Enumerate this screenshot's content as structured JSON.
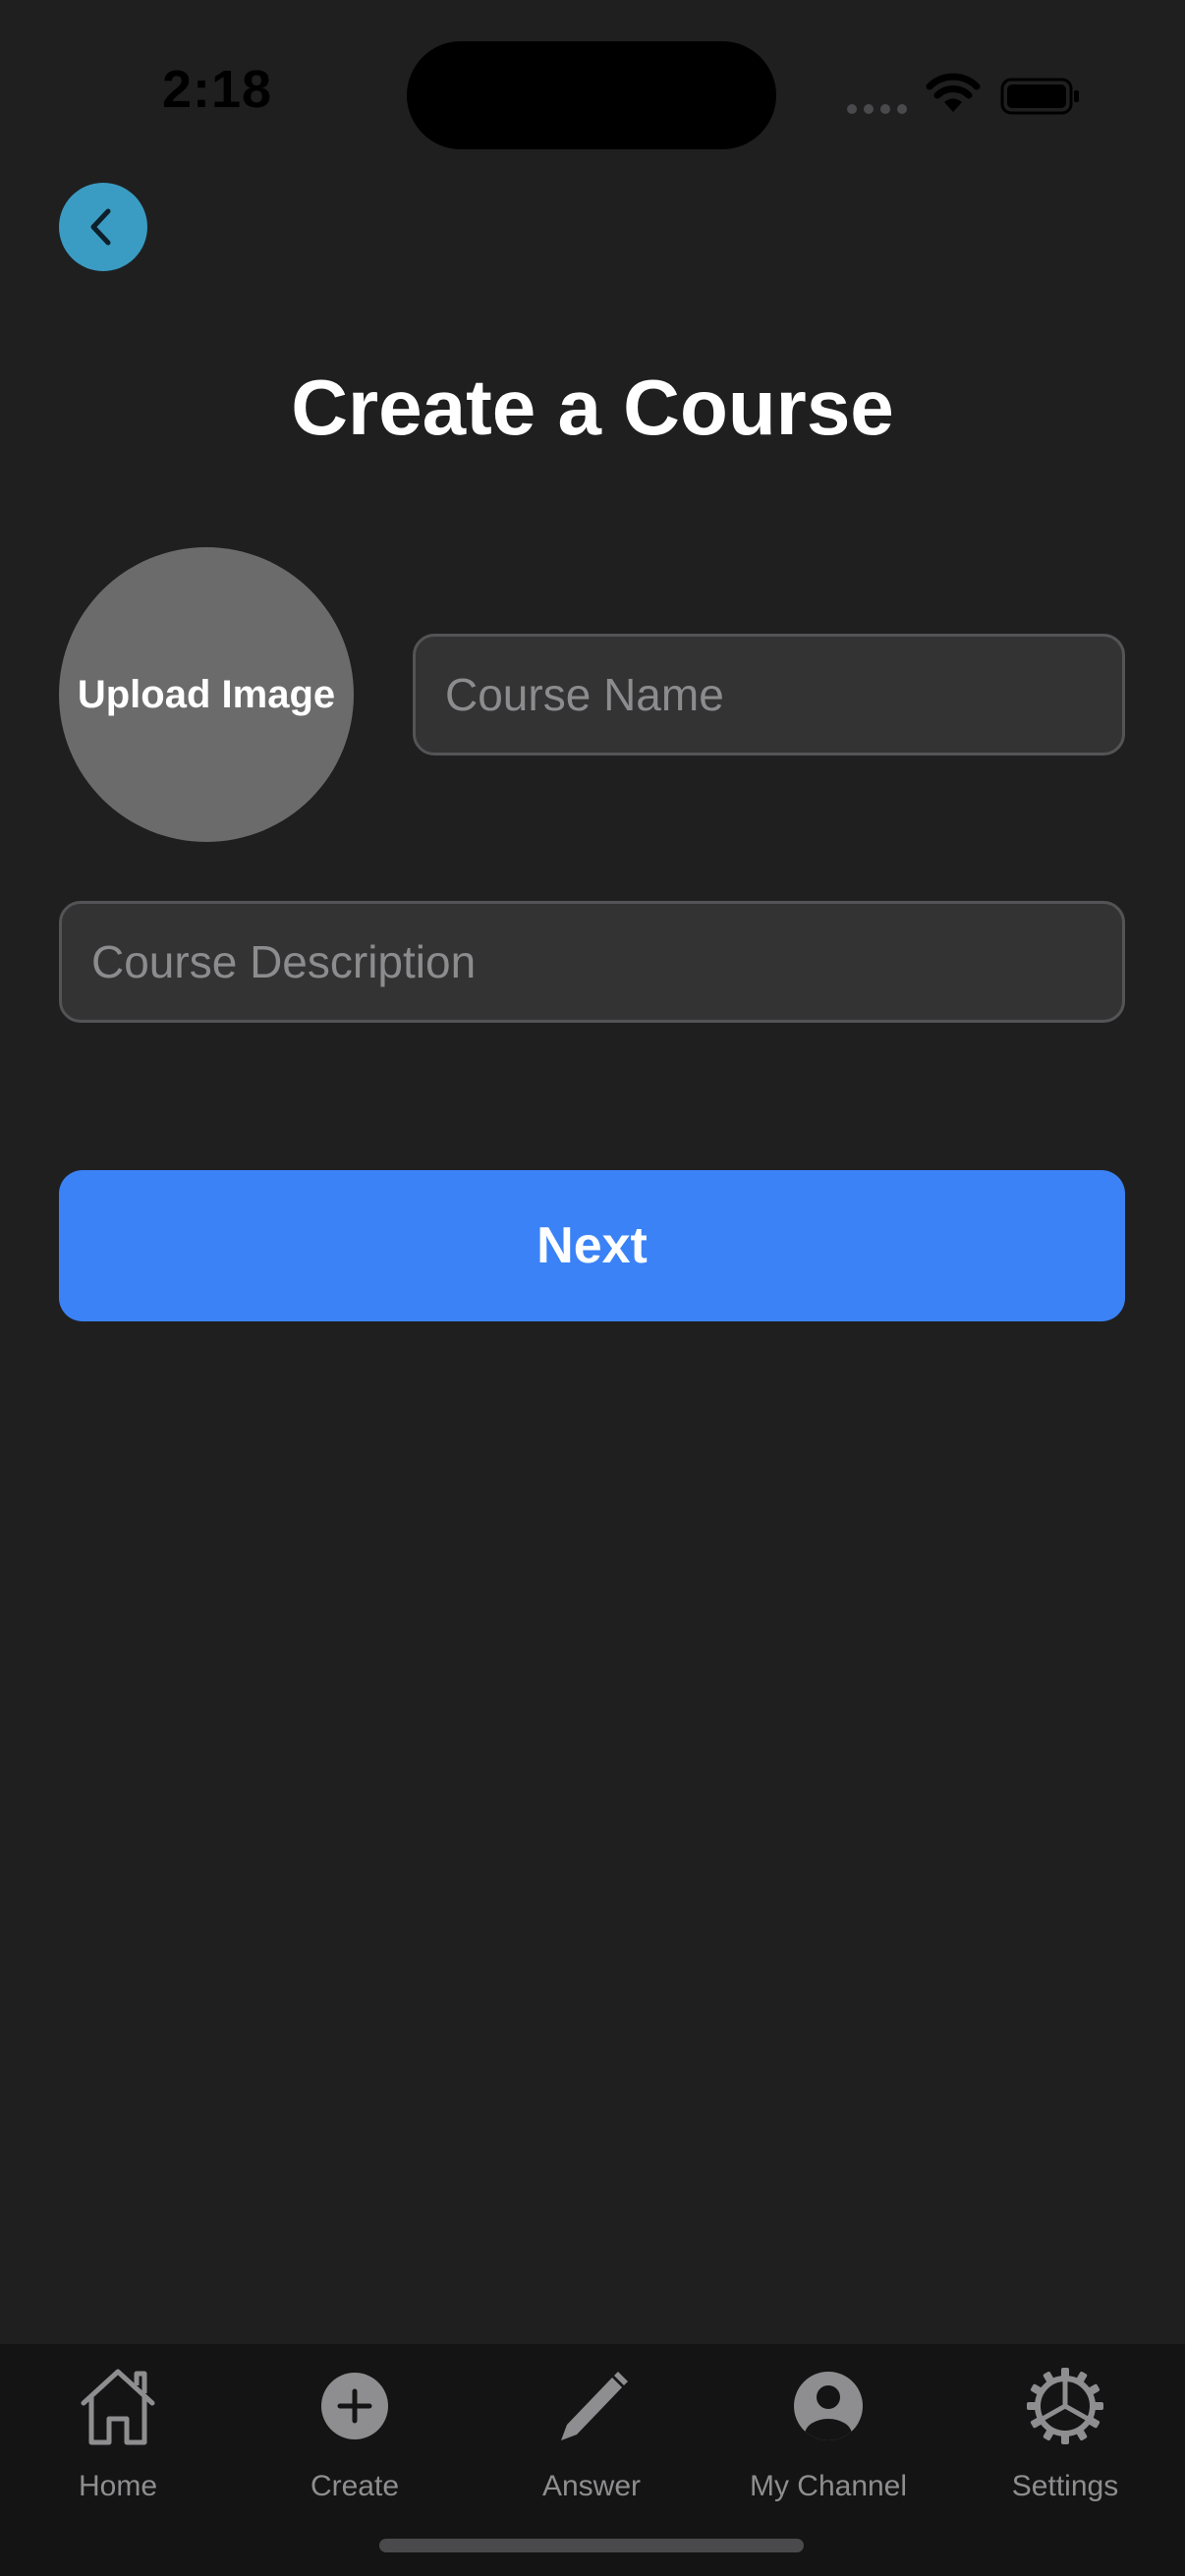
{
  "status_bar": {
    "time": "2:18"
  },
  "header": {
    "title": "Create a Course",
    "back_icon": "chevron-left-icon",
    "back_button_color": "#3a9cc3"
  },
  "form": {
    "upload_image_label": "Upload Image",
    "course_name": {
      "value": "",
      "placeholder": "Course Name"
    },
    "course_description": {
      "value": "",
      "placeholder": "Course Description"
    },
    "next_label": "Next",
    "next_button_color": "#3b82f6"
  },
  "tab_bar": {
    "items": [
      {
        "label": "Home",
        "icon": "house-icon"
      },
      {
        "label": "Create",
        "icon": "plus-circle-icon"
      },
      {
        "label": "Answer",
        "icon": "pencil-icon"
      },
      {
        "label": "My Channel",
        "icon": "person-circle-icon"
      },
      {
        "label": "Settings",
        "icon": "gear-icon"
      }
    ]
  }
}
